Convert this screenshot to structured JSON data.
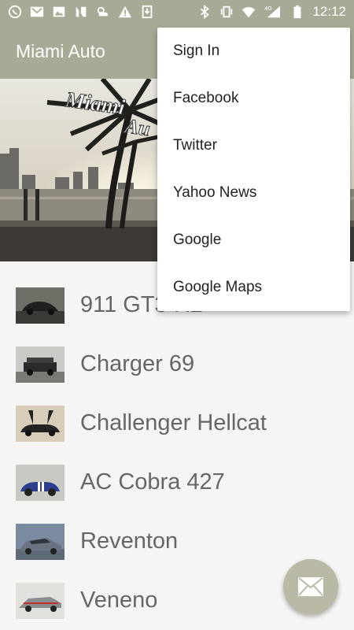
{
  "status_bar": {
    "time": "12:12",
    "network": "4G",
    "icons_left": [
      "whatsapp-icon",
      "gmail-icon",
      "image-icon",
      "n-icon",
      "weather-icon",
      "warning-icon",
      "download-icon"
    ],
    "icons_right": [
      "bluetooth-icon",
      "vibrate-icon",
      "wifi-icon",
      "signal-icon",
      "battery-icon"
    ]
  },
  "app_bar": {
    "title": "Miami Auto",
    "color": "#a9aa96"
  },
  "hero": {
    "text_line1": "Miami",
    "text_line2": "Au"
  },
  "cars": [
    {
      "name": "911 GT3 R2"
    },
    {
      "name": "Charger 69"
    },
    {
      "name": "Challenger Hellcat"
    },
    {
      "name": "AC Cobra 427"
    },
    {
      "name": "Reventon"
    },
    {
      "name": "Veneno"
    }
  ],
  "menu": {
    "items": [
      {
        "label": "Sign In"
      },
      {
        "label": "Facebook"
      },
      {
        "label": "Twitter"
      },
      {
        "label": "Yahoo News"
      },
      {
        "label": "Google"
      },
      {
        "label": "Google Maps"
      }
    ]
  },
  "fab": {
    "icon": "mail-icon",
    "color": "#b9b9a6"
  }
}
